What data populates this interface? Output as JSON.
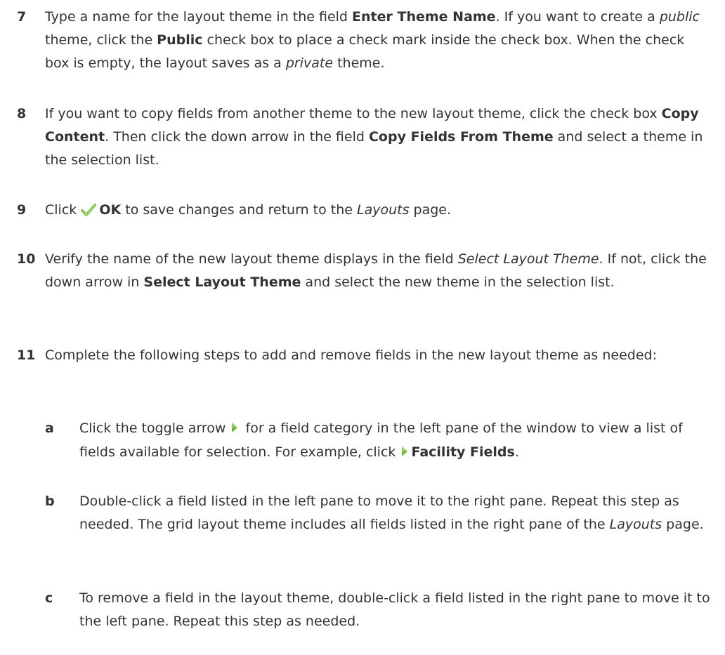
{
  "steps": [
    {
      "num": "7",
      "parts": {
        "p1": "Type a name for the layout theme in the field ",
        "b1": "Enter Theme Name",
        "p2": ". If you want to create a ",
        "i1": "public",
        "p3": " theme, click the ",
        "b2": "Public",
        "p4": " check box to place a check mark inside the check box. When the check box is empty, the layout saves as a ",
        "i2": "private",
        "p5": " theme."
      }
    },
    {
      "num": "8",
      "parts": {
        "p1": "If you want to copy fields from another theme to the new layout theme, click the check box ",
        "b1": "Copy Content",
        "p2": ". Then click the down arrow in the field ",
        "b2": "Copy Fields From Theme",
        "p3": " and select a theme in the selection list."
      }
    },
    {
      "num": "9",
      "parts": {
        "p1": "Click ",
        "b1": "OK",
        "p2": " to save changes and return to the ",
        "i1": "Layouts",
        "p3": " page."
      }
    },
    {
      "num": "10",
      "parts": {
        "p1": "Verify the name of the new layout theme displays in the field ",
        "i1": "Select Layout Theme",
        "p2": ". If not, click the down arrow in ",
        "b1": "Select Layout Theme",
        "p3": " and select the new theme in the selection list."
      }
    },
    {
      "num": "11",
      "parts": {
        "p1": "Complete the following steps to add and remove fields in the new layout theme as needed:"
      }
    }
  ],
  "substeps": [
    {
      "letter": "a",
      "parts": {
        "p1": "Click the toggle arrow ",
        "p2": " for a field category in the left pane of the window to view a list of fields available for selection. For example, click ",
        "b1": "Facility Fields",
        "p3": "."
      }
    },
    {
      "letter": "b",
      "parts": {
        "p1": "Double-click a field listed in the left pane to move it to the right pane. Repeat this step as needed. The grid layout theme includes all fields listed in the right pane of the ",
        "i1": "Layouts",
        "p2": " page."
      }
    },
    {
      "letter": "c",
      "parts": {
        "p1": "To remove a field in the layout theme, double-click a field listed in the right pane to move it to the left pane. Repeat this step as needed."
      }
    }
  ],
  "icons": {
    "ok_check": "check-mark-icon",
    "toggle_arrow": "toggle-arrow-icon"
  },
  "colors": {
    "text": "#333333",
    "check_green": "#7cc142",
    "arrow_green": "#6cb33f"
  }
}
